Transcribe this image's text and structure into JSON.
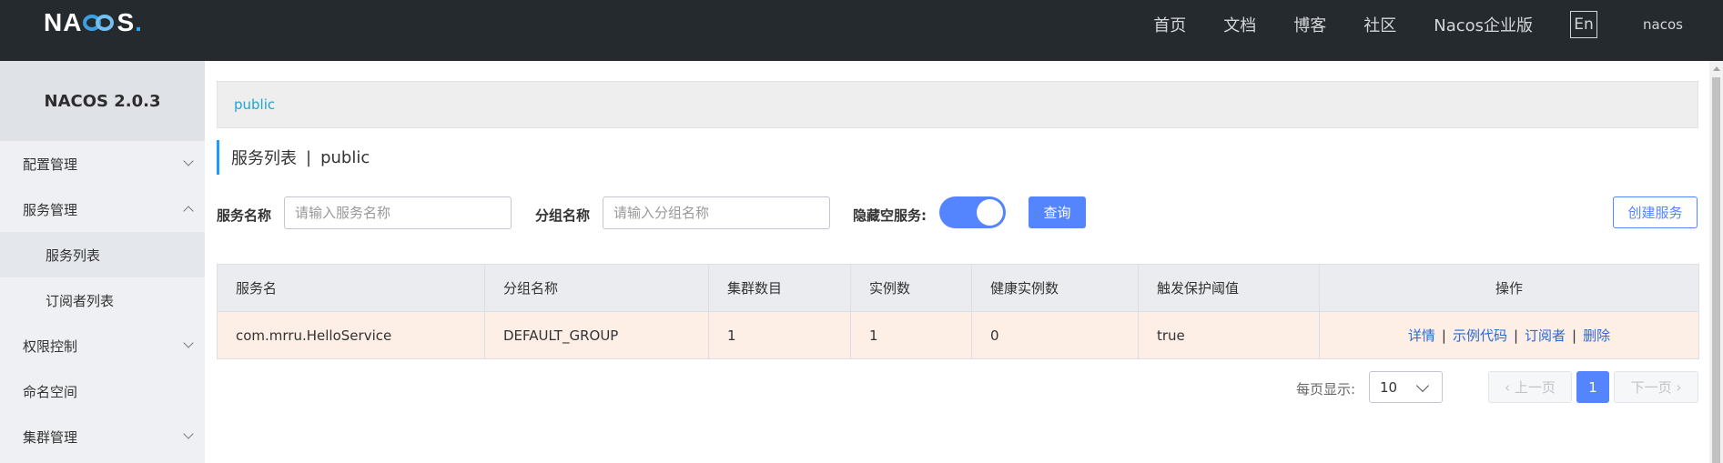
{
  "header": {
    "logo": {
      "prefix": "NA",
      "suffix": "S",
      "dot": "."
    },
    "nav": [
      "首页",
      "文档",
      "博客",
      "社区",
      "Nacos企业版"
    ],
    "lang": "En",
    "user": "nacos"
  },
  "sidebar": {
    "title": "NACOS 2.0.3",
    "items": [
      {
        "label": "配置管理"
      },
      {
        "label": "服务管理"
      },
      {
        "label": "服务列表"
      },
      {
        "label": "订阅者列表"
      },
      {
        "label": "权限控制"
      },
      {
        "label": "命名空间"
      },
      {
        "label": "集群管理"
      }
    ]
  },
  "main": {
    "breadcrumb": "public",
    "title": "服务列表",
    "title_sep": "|",
    "namespace": "public",
    "filters": {
      "service_name_label": "服务名称",
      "service_name_placeholder": "请输入服务名称",
      "group_name_label": "分组名称",
      "group_name_placeholder": "请输入分组名称",
      "hide_empty_label": "隐藏空服务:",
      "hide_empty_on": true,
      "query_button": "查询",
      "create_button": "创建服务"
    },
    "table": {
      "headers": [
        "服务名",
        "分组名称",
        "集群数目",
        "实例数",
        "健康实例数",
        "触发保护阈值",
        "操作"
      ],
      "rows": [
        {
          "service": "com.mrru.HelloService",
          "group": "DEFAULT_GROUP",
          "clusters": "1",
          "instances": "1",
          "healthy": "0",
          "threshold": "true",
          "ops": [
            "详情",
            "示例代码",
            "订阅者",
            "删除"
          ],
          "op_sep": "|"
        }
      ]
    },
    "pagination": {
      "page_size_label": "每页显示:",
      "page_size": "10",
      "prev": "上一页",
      "current": "1",
      "next": "下一页"
    }
  },
  "colors": {
    "header_bg": "#252a2f",
    "accent": "#5584ff",
    "link": "#1ea7cf",
    "row_highlight": "#fdeee6"
  }
}
